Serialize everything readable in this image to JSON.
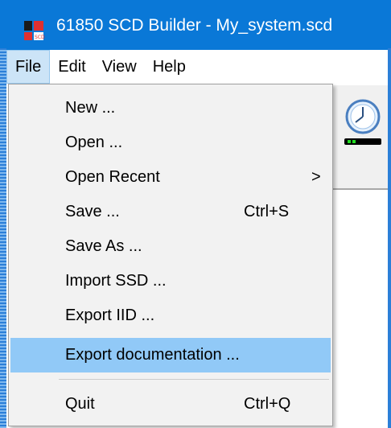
{
  "window": {
    "title": "61850 SCD Builder - My_system.scd",
    "app_icon": "scd-app-icon",
    "accent_color": "#0a78d7"
  },
  "menubar": {
    "items": [
      {
        "label": "File",
        "active": true
      },
      {
        "label": "Edit"
      },
      {
        "label": "View"
      },
      {
        "label": "Help"
      }
    ]
  },
  "file_menu": {
    "items": [
      {
        "label": "New ...",
        "shortcut": ""
      },
      {
        "label": "Open ...",
        "shortcut": ""
      },
      {
        "label": "Open Recent",
        "submenu_arrow": ">"
      },
      {
        "label": "Save ...",
        "shortcut": "Ctrl+S"
      },
      {
        "label": "Save As ...",
        "shortcut": ""
      },
      {
        "label": "Import SSD ...",
        "shortcut": ""
      },
      {
        "label": "Export IID ...",
        "shortcut": ""
      },
      {
        "label": "Export documentation ...",
        "shortcut": "",
        "highlighted": true
      },
      {
        "label": "Quit",
        "shortcut": "Ctrl+Q"
      }
    ],
    "highlight_color": "#91c9f7"
  },
  "toolbar": {
    "icons": [
      "clock-icon",
      "device-icon"
    ]
  }
}
